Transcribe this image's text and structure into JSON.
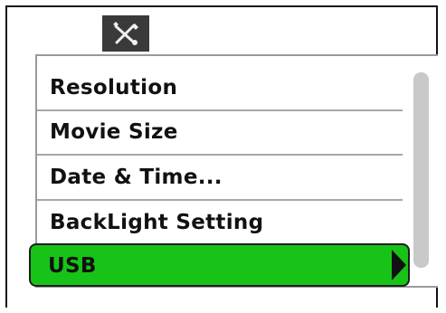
{
  "header": {
    "tab_icon": "tools-wrench-screwdriver-icon"
  },
  "menu": {
    "items": [
      {
        "label": "Resolution"
      },
      {
        "label": "Movie Size"
      },
      {
        "label": "Date & Time..."
      },
      {
        "label": "BackLight Setting"
      },
      {
        "label": "USB",
        "selected": true,
        "has_submenu": true
      }
    ]
  },
  "colors": {
    "selected_highlight": "#18c318",
    "tab_background": "#3a3a3a",
    "divider": "#a7a7a7",
    "scrollbar": "#c9c9c9"
  }
}
